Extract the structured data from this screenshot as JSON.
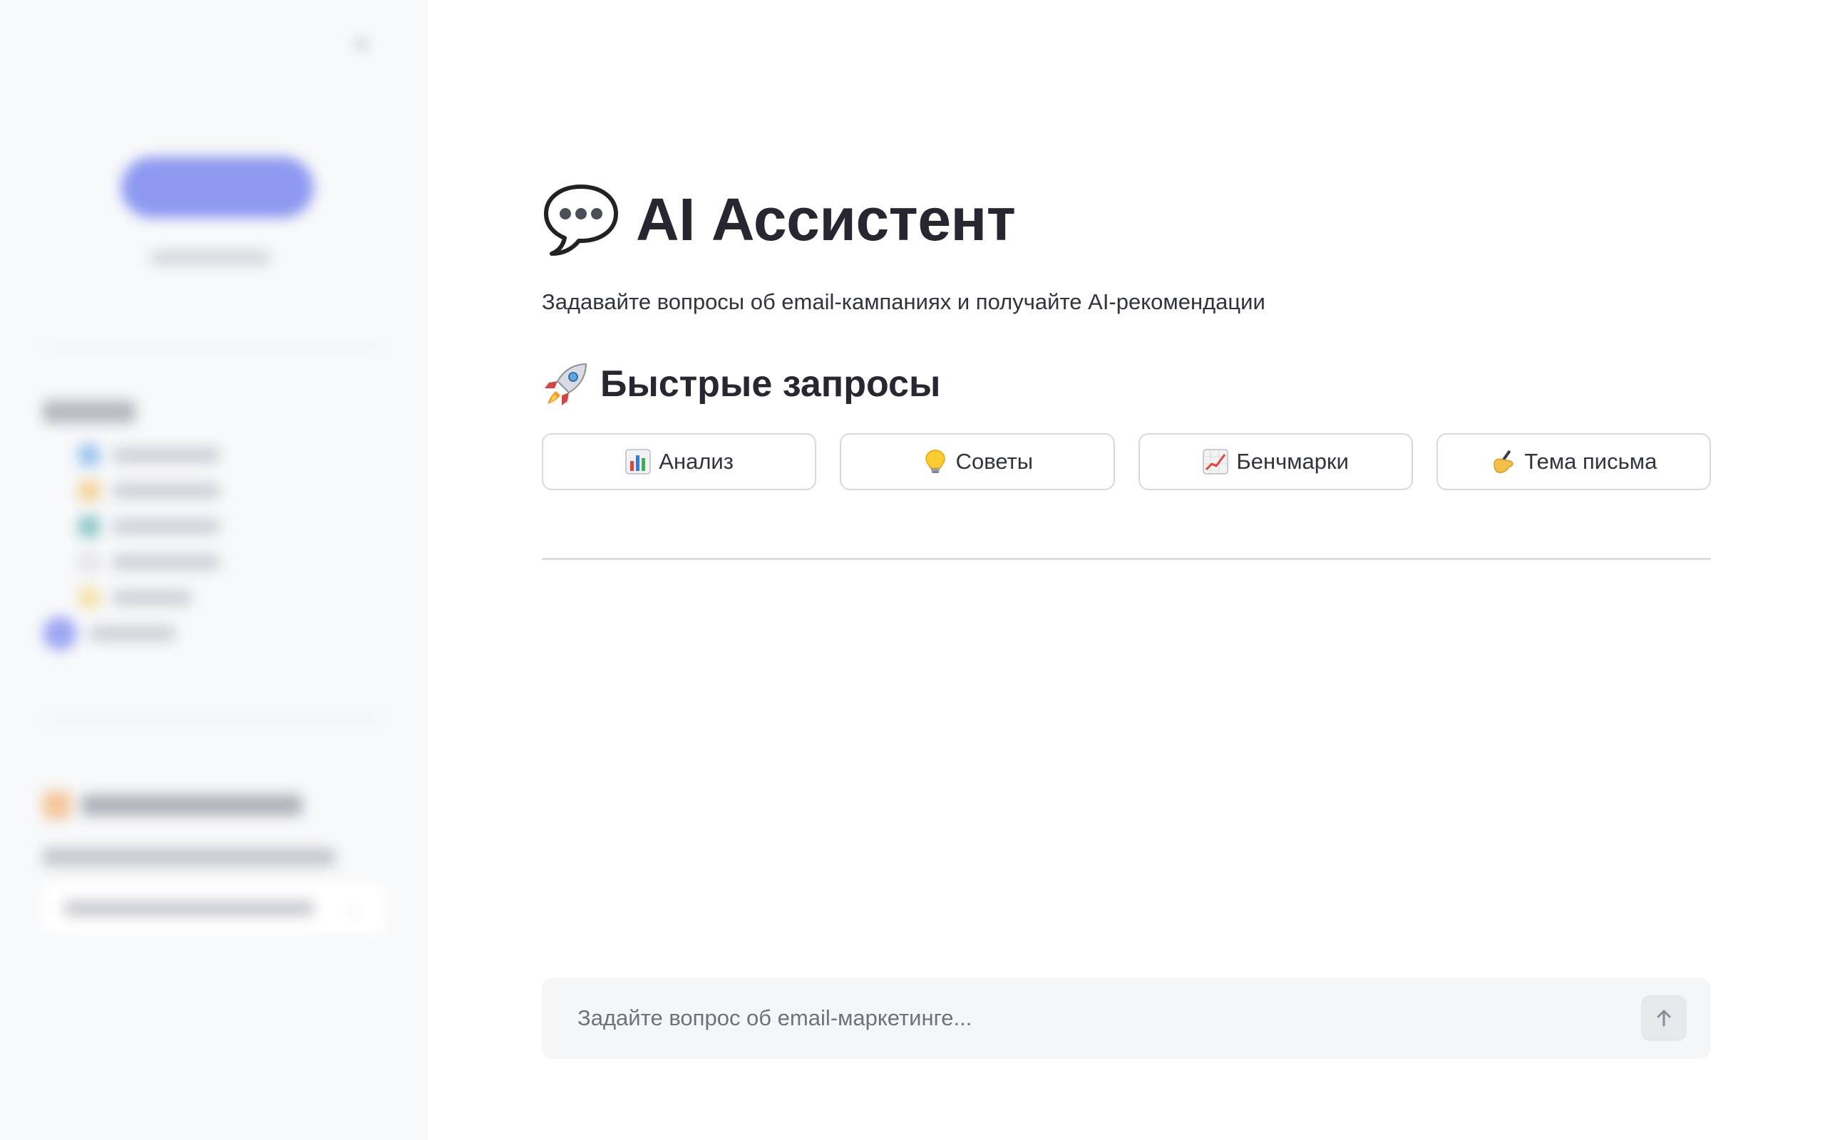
{
  "sidebar": {
    "collapse_glyph": "«"
  },
  "main": {
    "title": "AI Ассистент",
    "title_icon": "speech-bubble-icon",
    "subtitle": "Задавайте вопросы об email-кампаниях и получайте AI-рекомендации",
    "quick_section": {
      "title": "Быстрые запросы",
      "icon": "rocket-icon",
      "buttons": [
        {
          "label": "Анализ",
          "icon": "bar-chart-icon"
        },
        {
          "label": "Советы",
          "icon": "light-bulb-icon"
        },
        {
          "label": "Бенчмарки",
          "icon": "trend-up-chart-icon"
        },
        {
          "label": "Тема письма",
          "icon": "writing-hand-icon"
        }
      ]
    },
    "chat_input": {
      "placeholder": "Задайте вопрос об email-маркетинге...",
      "send_icon": "arrow-up-icon"
    }
  },
  "colors": {
    "sidebar_bg": "#f8f9fb",
    "text_primary": "#262730",
    "border": "#d8d9de",
    "input_bg": "#f5f6f8",
    "accent_blurred": "#8d99f0"
  }
}
